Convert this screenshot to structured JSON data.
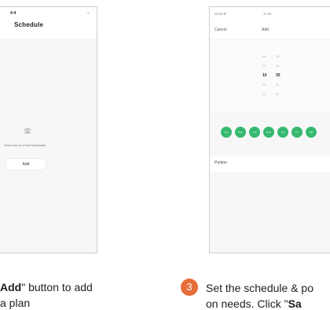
{
  "left_screen": {
    "status_left": "4:4",
    "status_right": "-",
    "title": "Schedule",
    "empty_text": "There are no Feed Schedules",
    "add_button_label": "Add"
  },
  "right_screen": {
    "status_left": "10:09 ☰",
    "status_mid": "17:33",
    "cancel_label": "Cancel",
    "add_label": "Add",
    "picker_rows": [
      {
        "h": "08",
        "m": "28",
        "selected": false
      },
      {
        "h": "09",
        "m": "29",
        "selected": false
      },
      {
        "h": "10",
        "m": "30",
        "selected": true
      },
      {
        "h": "11",
        "m": "31",
        "selected": false
      },
      {
        "h": "12",
        "m": "32",
        "selected": false
      }
    ],
    "days": [
      "Sun",
      "Mon",
      "Tue",
      "Wed",
      "Thu",
      "Fri",
      "Sat"
    ],
    "day_color": "#36b96f",
    "portion_label": "Portion"
  },
  "captions": {
    "left_line1_bold": "Add",
    "left_line1_rest": "\" button to add",
    "left_line2": "a plan",
    "right_line1": "Set the schedule & po",
    "right_line2_pre": "on needs. Click \"",
    "right_line2_bold": "Sa"
  },
  "step": {
    "number": "3",
    "color": "#e76d3b"
  }
}
